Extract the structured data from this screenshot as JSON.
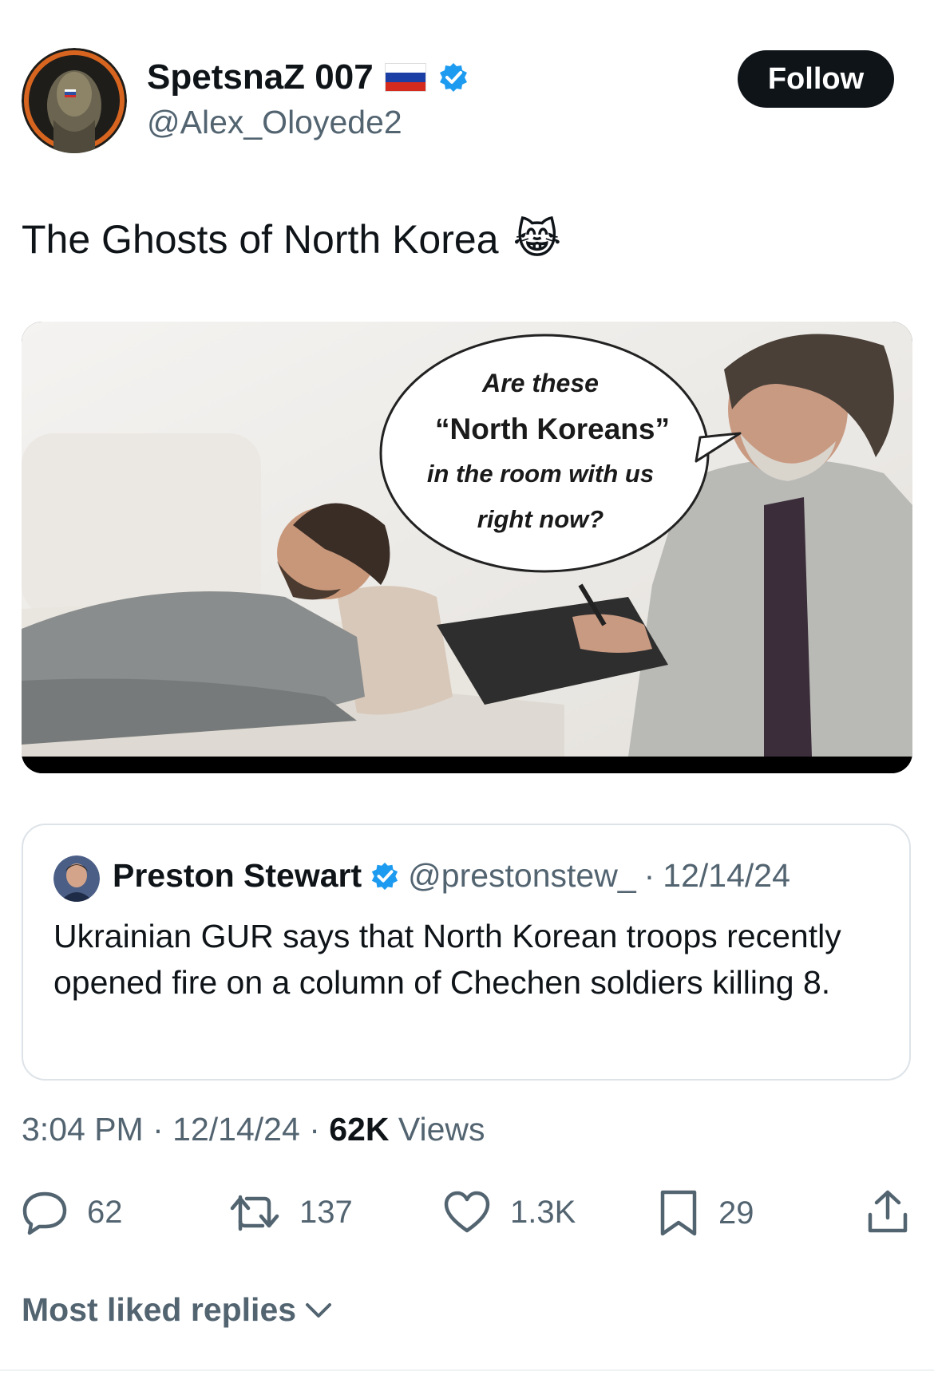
{
  "author": {
    "display_name": "SpetsnaZ 007",
    "handle": "@Alex_Oloyede2",
    "flag_icon": "russia-flag-icon",
    "verified_icon": "verified-badge-icon"
  },
  "follow_label": "Follow",
  "tweet": {
    "text": "The Ghosts of North Korea",
    "emoji": "😹"
  },
  "media": {
    "bubble_line1": "Are these",
    "bubble_line2": "“North Koreans”",
    "bubble_line3": "in the room with us",
    "bubble_line4": "right now?"
  },
  "quote": {
    "name": "Preston Stewart",
    "handle": "@prestonstew_",
    "separator": "·",
    "date": "12/14/24",
    "text": "Ukrainian GUR says that North Korean troops recently opened fire on a column of Chechen soldiers killing 8."
  },
  "meta": {
    "time": "3:04 PM",
    "separator": "·",
    "date": "12/14/24",
    "views_count": "62K",
    "views_label": "Views"
  },
  "actions": {
    "replies": "62",
    "reposts": "137",
    "likes": "1.3K",
    "bookmarks": "29"
  },
  "replies_section_label": "Most liked replies",
  "colors": {
    "text_primary": "#0f1419",
    "text_secondary": "#536471",
    "verified_blue": "#1d9bf0",
    "border": "#dde3e8"
  }
}
